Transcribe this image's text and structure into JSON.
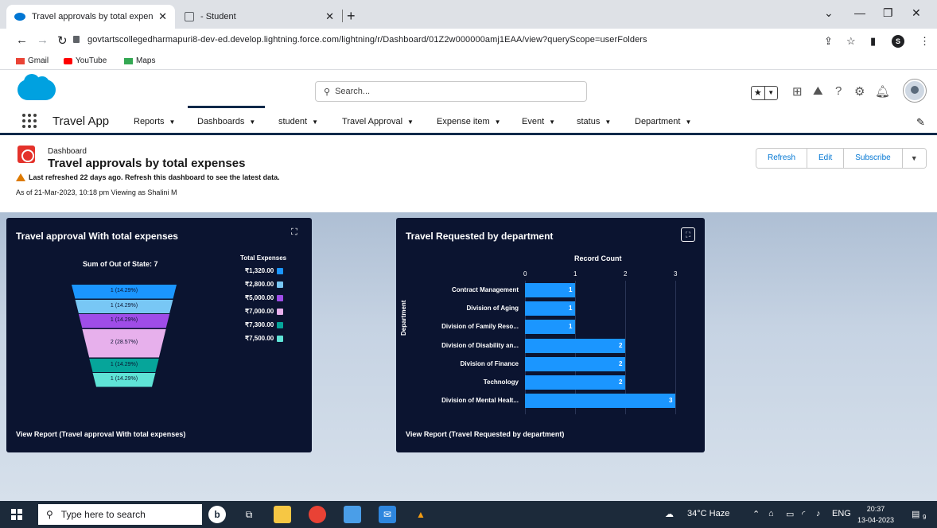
{
  "browser": {
    "tabs": [
      {
        "title": "Travel approvals by total expenses",
        "active": true
      },
      {
        "title": "- Student",
        "active": false
      }
    ],
    "url": "govtartscollegedharmapuri8-dev-ed.develop.lightning.force.com/lightning/r/Dashboard/01Z2w000000amj1EAA/view?queryScope=userFolders",
    "bookmarks": [
      "Gmail",
      "YouTube",
      "Maps"
    ],
    "profile_initial": "S"
  },
  "sf": {
    "search_placeholder": "Search...",
    "app_name": "Travel App",
    "nav": [
      "Reports",
      "Dashboards",
      "student",
      "Travel Approval",
      "Expense item",
      "Event",
      "status",
      "Department"
    ],
    "active_nav": "Dashboards"
  },
  "dashboard": {
    "type_label": "Dashboard",
    "title": "Travel approvals by total expenses",
    "warning": "Last refreshed 22 days ago. Refresh this dashboard to see the latest data.",
    "as_of": "As of 21-Mar-2023, 10:18 pm Viewing as Shalini M",
    "buttons": {
      "refresh": "Refresh",
      "edit": "Edit",
      "subscribe": "Subscribe"
    }
  },
  "widgets": {
    "funnel": {
      "title": "Travel approval With total expenses",
      "footer": "View Report (Travel approval With total expenses)"
    },
    "bars": {
      "title": "Travel Requested by department",
      "footer": "View Report (Travel Requested by department)"
    }
  },
  "chart_data": [
    {
      "type": "funnel",
      "title": "Sum of Out of State: 7",
      "legend_title": "Total Expenses",
      "categories": [
        "₹1,320.00",
        "₹2,800.00",
        "₹5,000.00",
        "₹7,000.00",
        "₹7,300.00",
        "₹7,500.00"
      ],
      "values": [
        1,
        1,
        1,
        2,
        1,
        1
      ],
      "labels": [
        "1 (14.29%)",
        "1 (14.29%)",
        "1 (14.29%)",
        "2 (28.57%)",
        "1 (14.29%)",
        "1 (14.29%)"
      ],
      "colors": [
        "#1b96ff",
        "#78c7f5",
        "#9f4de8",
        "#e7b0ec",
        "#06a59a",
        "#5fe3d6"
      ]
    },
    {
      "type": "bar",
      "orientation": "horizontal",
      "xlabel": "Record Count",
      "ylabel": "Department",
      "categories": [
        "Contract Management",
        "Division of Aging",
        "Division of Family Reso...",
        "Division of Disability an...",
        "Division of Finance",
        "Technology",
        "Division of Mental Healt..."
      ],
      "values": [
        1,
        1,
        1,
        2,
        2,
        2,
        3
      ],
      "xlim": [
        0,
        3
      ],
      "xticks": [
        0,
        1,
        2,
        3
      ],
      "color": "#1b96ff"
    }
  ],
  "taskbar": {
    "search_placeholder": "Type here to search",
    "weather": "34°C Haze",
    "lang": "ENG",
    "time": "20:37",
    "date": "13-04-2023",
    "notif_count": "9"
  }
}
